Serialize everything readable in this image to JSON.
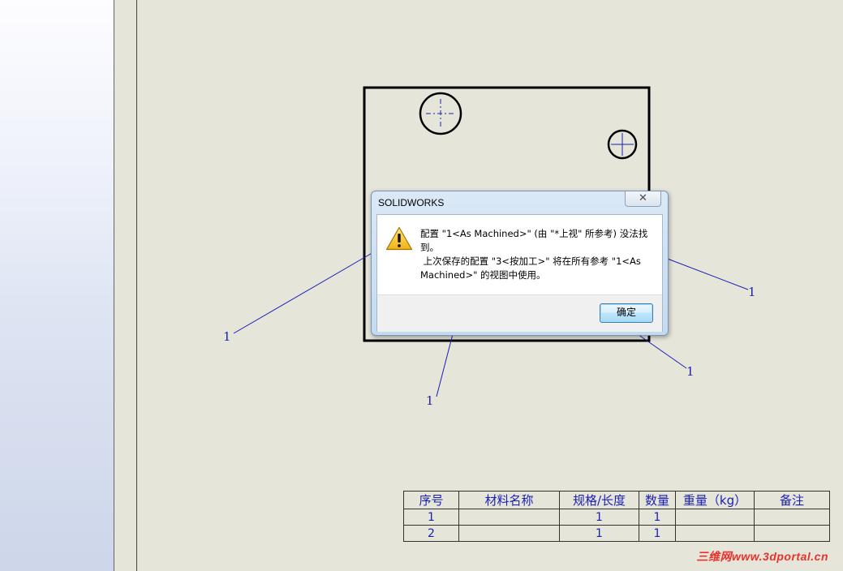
{
  "dialog": {
    "title": "SOLIDWORKS",
    "close_symbol": "✕",
    "message_line1": "配置 \"1<As Machined>\" (由 \"*上视\" 所参考) 没法找",
    "message_line2": "到。",
    "message_line3": " 上次保存的配置 \"3<按加工>\" 将在所有参考 \"1<As",
    "message_line4": "Machined>\" 的视图中使用。",
    "ok_label": "确定",
    "icon": "warning-icon"
  },
  "balloons": [
    "1",
    "1",
    "1",
    "1"
  ],
  "bom": {
    "headers": [
      "序号",
      "材料名称",
      "规格/长度",
      "数量",
      "重量（kg）",
      "备注"
    ],
    "rows": [
      [
        "1",
        "",
        "1",
        "1",
        "",
        ""
      ],
      [
        "2",
        "",
        "1",
        "1",
        "",
        ""
      ]
    ]
  },
  "watermark": "三维网www.3dportal.cn",
  "colors": {
    "annotation": "#1a1fb3",
    "sheet": "#e6e5da",
    "watermark": "#e8322c"
  }
}
